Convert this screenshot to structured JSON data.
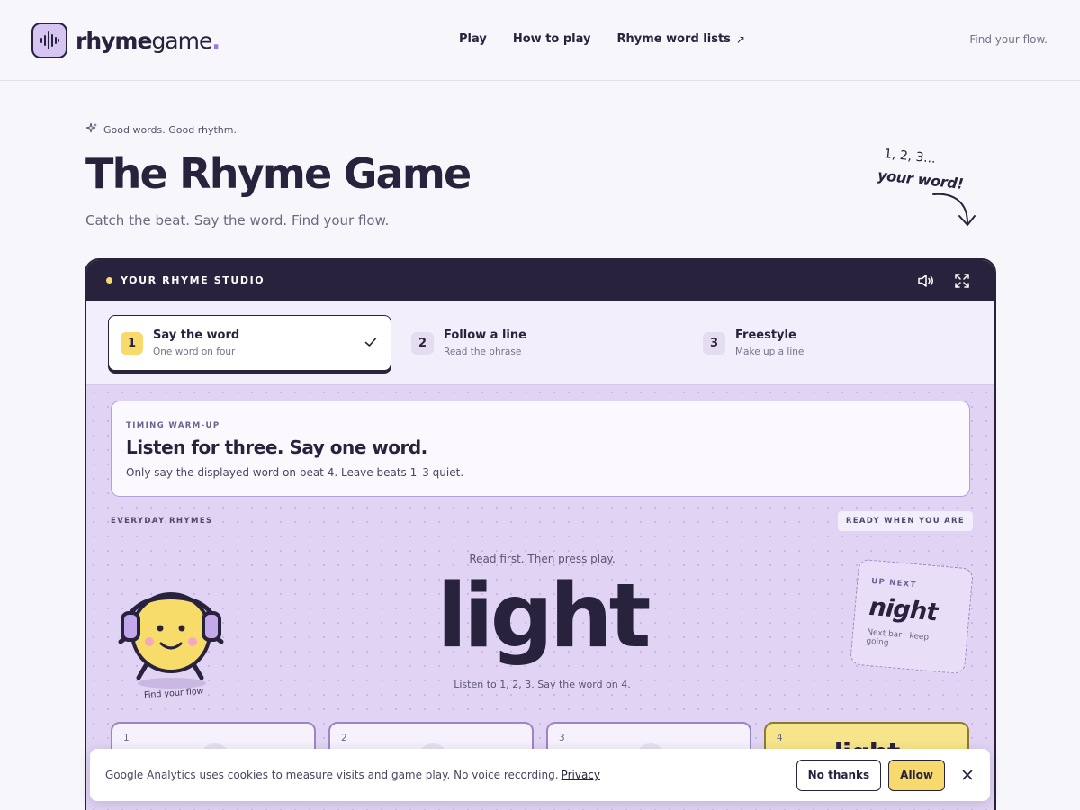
{
  "header": {
    "logo_bold": "rhyme",
    "logo_light": "game",
    "logo_dot": ".",
    "nav": [
      {
        "label": "Play"
      },
      {
        "label": "How to play"
      },
      {
        "label": "Rhyme word lists"
      }
    ],
    "tagline": "Find your flow."
  },
  "hero": {
    "eyebrow": "Good words. Good rhythm.",
    "title": "The Rhyme Game",
    "subtitle": "Catch the beat. Say the word. Find your flow.",
    "scribble_count": "1, 2, 3...",
    "scribble_word": "your word!"
  },
  "studio": {
    "label": "YOUR RHYME STUDIO",
    "icons": [
      "volume-icon",
      "fullscreen-icon"
    ],
    "steps": [
      {
        "num": "1",
        "title": "Say the word",
        "sub": "One word on four",
        "active": true
      },
      {
        "num": "2",
        "title": "Follow a line",
        "sub": "Read the phrase",
        "active": false
      },
      {
        "num": "3",
        "title": "Freestyle",
        "sub": "Make up a line",
        "active": false
      }
    ],
    "warmup": {
      "kicker": "TIMING WARM-UP",
      "heading": "Listen for three. Say one word.",
      "text": "Only say the displayed word on beat 4. Leave beats 1–3 quiet."
    },
    "section_label": "EVERYDAY RHYMES",
    "ready_badge": "READY WHEN YOU ARE",
    "read_first": "Read first. Then press play.",
    "word": "light",
    "listen_hint": "Listen to 1, 2, 3. Say the word on 4.",
    "mascot_caption": "Find your flow",
    "up_next": {
      "kicker": "UP NEXT",
      "word": "night",
      "sub": "Next bar · keep going"
    },
    "beats": [
      {
        "num": "1",
        "word": ""
      },
      {
        "num": "2",
        "word": ""
      },
      {
        "num": "3",
        "word": ""
      },
      {
        "num": "4",
        "word": "light"
      }
    ]
  },
  "cookie": {
    "message": "Google Analytics uses cookies to measure visits and game play. No voice recording.",
    "privacy": "Privacy",
    "no_thanks": "No thanks",
    "allow": "Allow"
  },
  "colors": {
    "ink": "#28223d",
    "accent_yellow": "#f7d96c",
    "accent_purple": "#d6c4f2",
    "stage_bg": "#e0d3f3"
  }
}
